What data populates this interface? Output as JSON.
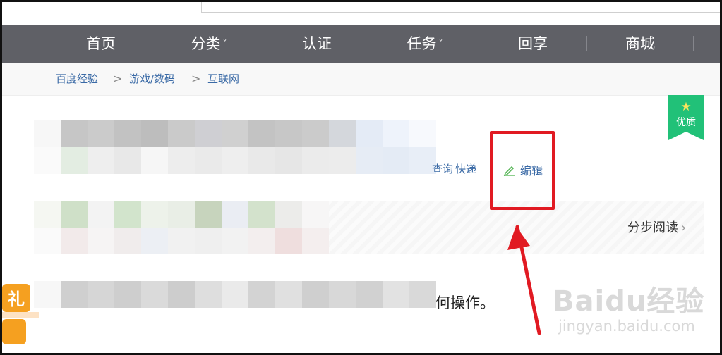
{
  "nav": {
    "items": [
      {
        "label": "首页",
        "has_caret": false
      },
      {
        "label": "分类",
        "has_caret": true
      },
      {
        "label": "认证",
        "has_caret": false
      },
      {
        "label": "任务",
        "has_caret": true
      },
      {
        "label": "回享",
        "has_caret": false
      },
      {
        "label": "商城",
        "has_caret": false
      }
    ],
    "caret": "ˇ"
  },
  "breadcrumb": {
    "items": [
      "百度经验",
      "游戏/数码",
      "互联网"
    ],
    "separator": ">"
  },
  "badge": {
    "label": "优质",
    "star": "★",
    "color": "#21c178"
  },
  "article": {
    "tag_partial": "查询",
    "tag_express": "快递",
    "edit_label": "编辑",
    "step_read_label": "分步阅读",
    "step_read_arrow": "›",
    "intro_tail": "何操作。"
  },
  "watermark": {
    "brand": "Baidu经验",
    "url": "jingyan.baidu.com"
  },
  "gift": {
    "text": "礼"
  },
  "colors": {
    "nav_bg": "#5f6066",
    "link": "#3a6aa6",
    "annotation": "#e11a22",
    "edit_icon": "#5cb85c"
  }
}
